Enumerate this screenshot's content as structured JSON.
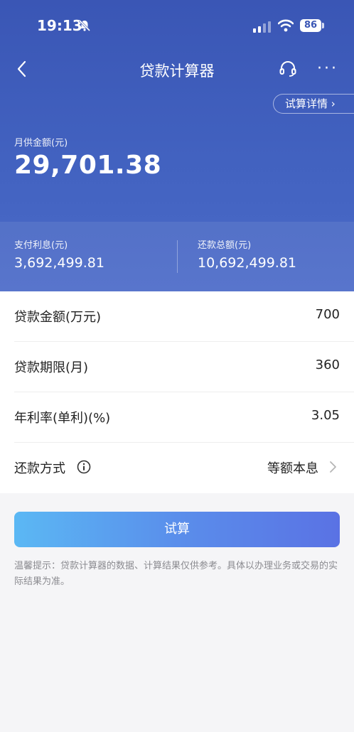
{
  "status": {
    "time": "19:13",
    "battery": "86"
  },
  "nav": {
    "title": "贷款计算器"
  },
  "header": {
    "detail_label": "试算详情 ›",
    "monthly_label": "月供金额(元)",
    "monthly_value": "29,701.38",
    "interest_label": "支付利息(元)",
    "interest_value": "3,692,499.81",
    "total_label": "还款总额(元)",
    "total_value": "10,692,499.81"
  },
  "form": {
    "amount_label": "贷款金额(万元)",
    "amount_value": "700",
    "term_label": "贷款期限(月)",
    "term_value": "360",
    "rate_label": "年利率(单利)(%)",
    "rate_value": "3.05",
    "method_label": "还款方式",
    "method_value": "等额本息"
  },
  "actions": {
    "calculate_label": "试算"
  },
  "tip": "温馨提示：贷款计算器的数据、计算结果仅供参考。具体以办理业务或交易的实际结果为准。",
  "colors": {
    "primary": "#3a56b5",
    "button_start": "#5bb8f4",
    "button_end": "#5a72e4"
  }
}
